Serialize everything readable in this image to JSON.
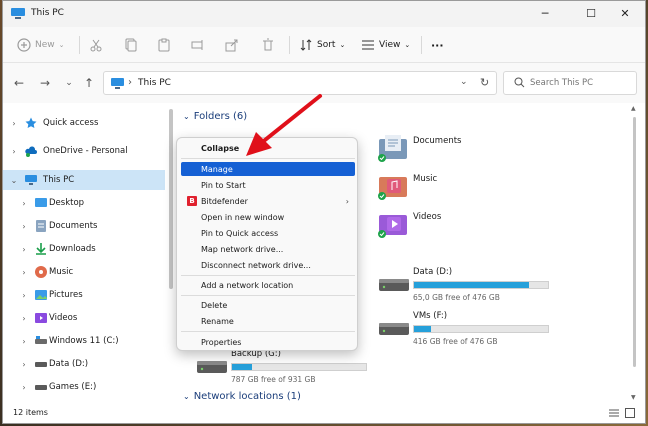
{
  "window": {
    "title": "This PC"
  },
  "titlebar": {
    "minimize": "─",
    "maximize": "☐",
    "close": "✕"
  },
  "commandbar": {
    "new_label": "New",
    "sort_label": "Sort",
    "view_label": "View",
    "more_label": "···"
  },
  "address": {
    "crumb": "This PC",
    "search_placeholder": "Search This PC"
  },
  "sidebar": {
    "items": [
      {
        "label": "Quick access"
      },
      {
        "label": "OneDrive - Personal"
      },
      {
        "label": "This PC"
      },
      {
        "label": "Desktop"
      },
      {
        "label": "Documents"
      },
      {
        "label": "Downloads"
      },
      {
        "label": "Music"
      },
      {
        "label": "Pictures"
      },
      {
        "label": "Videos"
      },
      {
        "label": "Windows 11 (C:)"
      },
      {
        "label": "Data (D:)"
      },
      {
        "label": "Games (E:)"
      }
    ]
  },
  "main": {
    "folders_header": "Folders (6)",
    "network_header": "Network locations (1)",
    "folders": [
      {
        "label": "Documents"
      },
      {
        "label": "Music"
      },
      {
        "label": "Videos"
      }
    ],
    "drives": [
      {
        "name": "Data (D:)",
        "free": "65,0 GB free of 476 GB",
        "used_fraction": 0.86
      },
      {
        "name": "VMs (F:)",
        "free": "416 GB free of 476 GB",
        "used_fraction": 0.13
      },
      {
        "name": "Backup (G:)",
        "free": "787 GB free of 931 GB",
        "used_fraction": 0.15
      }
    ]
  },
  "context_menu": {
    "items": [
      "Collapse",
      "Manage",
      "Pin to Start",
      "Bitdefender",
      "Open in new window",
      "Pin to Quick access",
      "Map network drive...",
      "Disconnect network drive...",
      "Add a network location",
      "Delete",
      "Rename",
      "Properties"
    ],
    "bitdefender_logo": "B"
  },
  "status": {
    "count": "12 items"
  },
  "colors": {
    "accent": "#1560d4",
    "selection": "#cce4f7",
    "arrow": "#e0101a",
    "drive_fill": "#26a0da"
  }
}
